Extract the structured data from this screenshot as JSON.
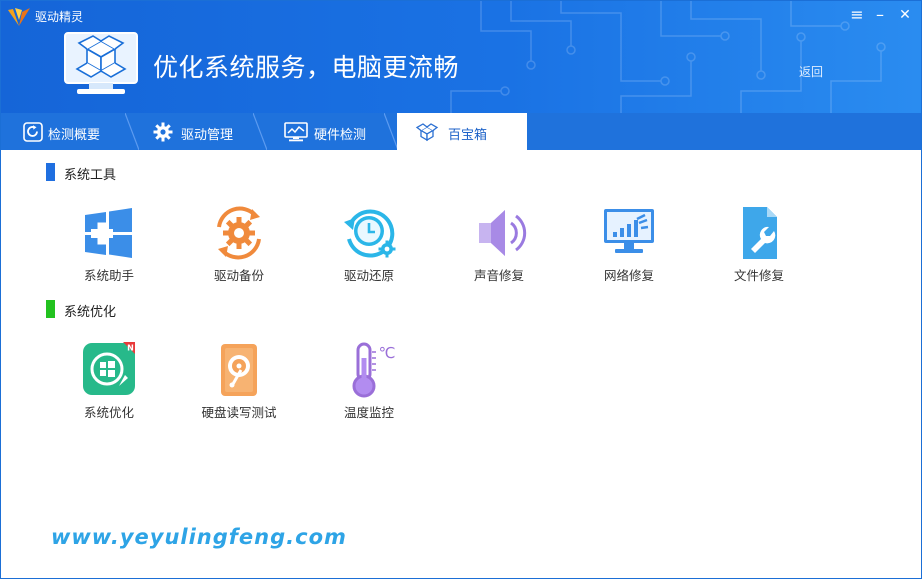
{
  "window": {
    "title": "驱动精灵"
  },
  "controls": {
    "menu": "≡",
    "minimize": "–",
    "close": "✕"
  },
  "header": {
    "headline": "优化系统服务，电脑更流畅",
    "back_label": "返回"
  },
  "tabs": [
    {
      "label": "检测概要",
      "icon": "refresh-icon"
    },
    {
      "label": "驱动管理",
      "icon": "gear-icon"
    },
    {
      "label": "硬件检测",
      "icon": "monitor-chart-icon"
    },
    {
      "label": "百宝箱",
      "icon": "toolbox-icon",
      "active": true
    }
  ],
  "sections": [
    {
      "title": "系统工具",
      "accent": "#1f6fe0",
      "items": [
        {
          "label": "系统助手",
          "icon": "windows-plus-icon"
        },
        {
          "label": "驱动备份",
          "icon": "gear-backup-icon"
        },
        {
          "label": "驱动还原",
          "icon": "clock-restore-icon"
        },
        {
          "label": "声音修复",
          "icon": "speaker-icon"
        },
        {
          "label": "网络修复",
          "icon": "network-monitor-icon"
        },
        {
          "label": "文件修复",
          "icon": "file-wrench-icon"
        }
      ]
    },
    {
      "title": "系统优化",
      "accent": "#22c21f",
      "items": [
        {
          "label": "系统优化",
          "icon": "rocket-windows-icon",
          "badge": "N"
        },
        {
          "label": "硬盘读写测试",
          "icon": "hard-disk-icon"
        },
        {
          "label": "温度监控",
          "icon": "thermometer-icon",
          "unit": "℃"
        }
      ]
    }
  ],
  "watermark": "www.yeyulingfeng.com"
}
